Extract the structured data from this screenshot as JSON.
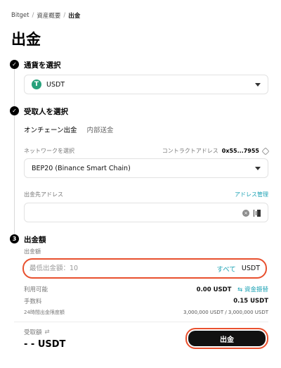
{
  "breadcrumb": {
    "root": "Bitget",
    "middle": "資産概要",
    "current": "出金",
    "separator": "/"
  },
  "page": {
    "title": "出金"
  },
  "steps": [
    {
      "title": "通貨を選択",
      "badge": "✓"
    },
    {
      "title": "受取人を選択",
      "badge": "✓"
    },
    {
      "title": "出金額",
      "badge": "3"
    }
  ],
  "coin": {
    "symbol": "USDT",
    "logo_letter": "T"
  },
  "tabs": [
    {
      "label": "オンチェーン出金"
    },
    {
      "label": "内部送金"
    }
  ],
  "network": {
    "label": "ネットワークを選択",
    "value": "BEP20 (Binance Smart Chain)",
    "contract_label": "コントラクトアドレス",
    "contract_value": "0x55...7955"
  },
  "address": {
    "label": "出金先アドレス",
    "book_link": "アドレス管理",
    "placeholder": ""
  },
  "amount": {
    "label": "出金額",
    "placeholder": "最低出金額：10",
    "all_label": "すべて",
    "unit": "USDT"
  },
  "info": {
    "available_label": "利用可能",
    "available_value": "0.00 USDT",
    "transfer_link": "⇆ 資金振替",
    "fee_label": "手数料",
    "fee_value": "0.15 USDT",
    "limit_label": "24時間出金限度額",
    "limit_value": "3,000,000 USDT / 3,000,000 USDT"
  },
  "receive": {
    "label": "受取額",
    "swap_icon": "⇄",
    "value": "- - USDT"
  },
  "submit": {
    "label": "出金"
  },
  "colors": {
    "accent": "#1da2b4",
    "highlight": "#e8502e",
    "tether": "#26a17b"
  }
}
